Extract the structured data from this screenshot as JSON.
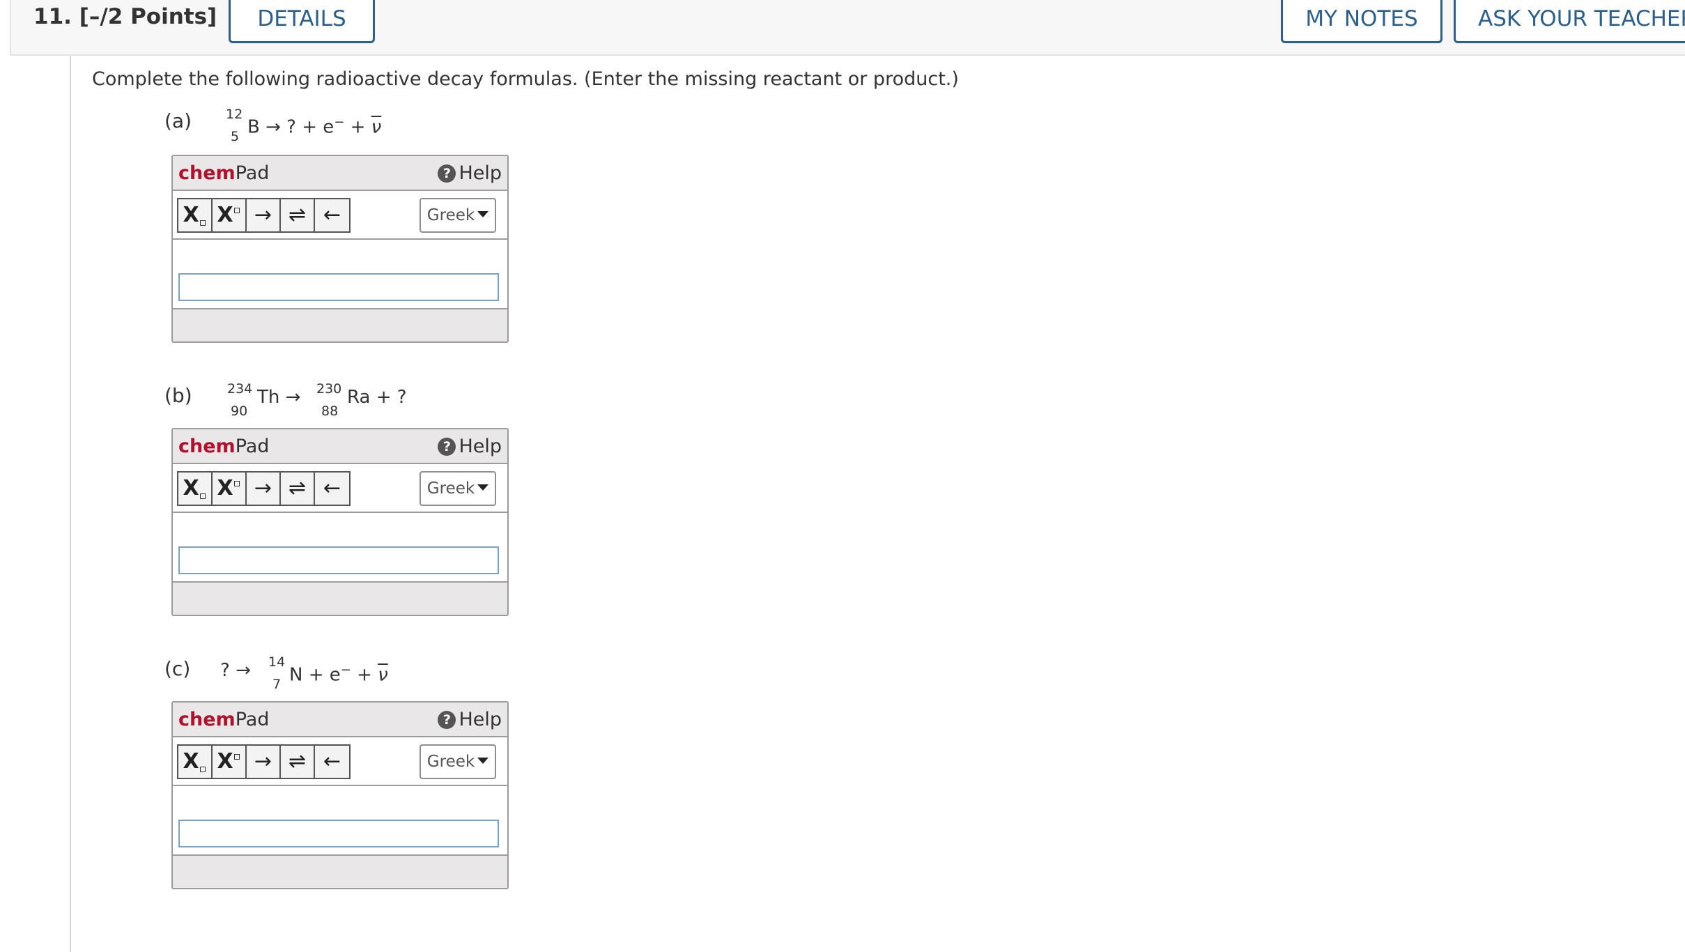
{
  "header": {
    "question_number": "11.",
    "points": "[–/2 Points]",
    "details_label": "DETAILS",
    "my_notes_label": "MY NOTES",
    "ask_teacher_label": "ASK YOUR TEACHER"
  },
  "intro": "Complete the following radioactive decay formulas. (Enter the missing reactant or product.)",
  "parts": [
    {
      "label": "(a)",
      "nuclide1": {
        "mass": "12",
        "atomic": "5",
        "symbol": "B"
      },
      "text_after_1": "→ ? + e",
      "electron_sup": "−",
      "plus": "+",
      "antineutrino": "ν"
    },
    {
      "label": "(b)",
      "nuclide1": {
        "mass": "234",
        "atomic": "90",
        "symbol": "Th"
      },
      "arrow": "→",
      "nuclide2": {
        "mass": "230",
        "atomic": "88",
        "symbol": "Ra"
      },
      "tail": "+ ?"
    },
    {
      "label": "(c)",
      "head": "? →",
      "nuclide1": {
        "mass": "14",
        "atomic": "7",
        "symbol": "N"
      },
      "text_after_1": "+ e",
      "electron_sup": "−",
      "plus": "+",
      "antineutrino": "ν"
    }
  ],
  "chempad": {
    "brand_part1": "chem",
    "brand_part2": "Pad",
    "help_label": "Help",
    "help_icon": "?",
    "toolbar": {
      "subscript_label": "X",
      "superscript_label": "X",
      "box_glyph": "▫",
      "right_arrow": "→",
      "equilibrium_arrow": "⇌",
      "left_arrow": "←"
    },
    "greek_label": "Greek",
    "input_value": ""
  },
  "colors": {
    "accent": "#2c5f8a",
    "brand_red": "#b0122d",
    "input_border": "#7aa2c7"
  }
}
